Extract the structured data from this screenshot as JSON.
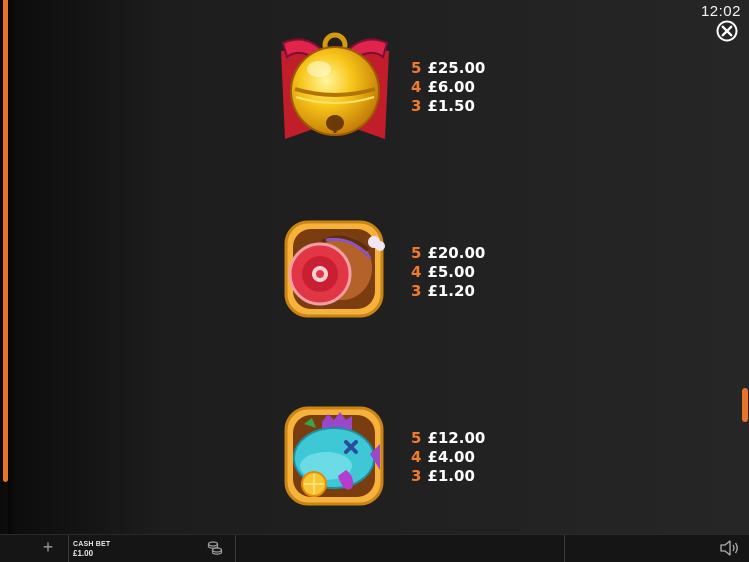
{
  "status": {
    "clock": "12:02"
  },
  "icons": {
    "close": "close-icon",
    "plus": "plus-icon",
    "coins": "coins-icon",
    "sound": "speaker-icon"
  },
  "paytable": [
    {
      "symbol": "golden-bell-icon",
      "pays": [
        {
          "count": "5",
          "amount": "£25.00"
        },
        {
          "count": "4",
          "amount": "£6.00"
        },
        {
          "count": "3",
          "amount": "£1.50"
        }
      ]
    },
    {
      "symbol": "ham-icon",
      "pays": [
        {
          "count": "5",
          "amount": "£20.00"
        },
        {
          "count": "4",
          "amount": "£5.00"
        },
        {
          "count": "3",
          "amount": "£1.20"
        }
      ]
    },
    {
      "symbol": "fish-icon",
      "pays": [
        {
          "count": "5",
          "amount": "£12.00"
        },
        {
          "count": "4",
          "amount": "£4.00"
        },
        {
          "count": "3",
          "amount": "£1.00"
        }
      ]
    }
  ],
  "bottom_bar": {
    "plus_label": "+",
    "cash_bet_label": "CASH BET",
    "cash_bet_value": "£1.00"
  },
  "colors": {
    "accent": "#e8732a",
    "text": "#ffffff",
    "background": "#222222"
  }
}
